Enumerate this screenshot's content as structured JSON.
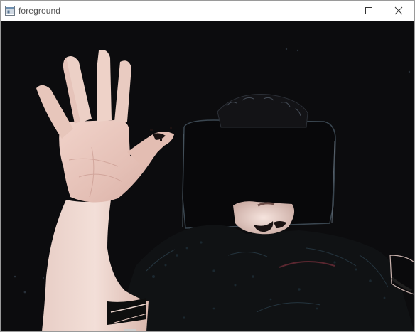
{
  "window": {
    "title": "foreground",
    "icon": "opencv-window-icon",
    "controls": [
      "minimize-icon",
      "maximize-icon",
      "close-icon"
    ]
  },
  "image": {
    "description_icon": "foreground-mask-video-frame",
    "background_color": "#0c0c0e",
    "skin_color": "#e9c8be"
  }
}
